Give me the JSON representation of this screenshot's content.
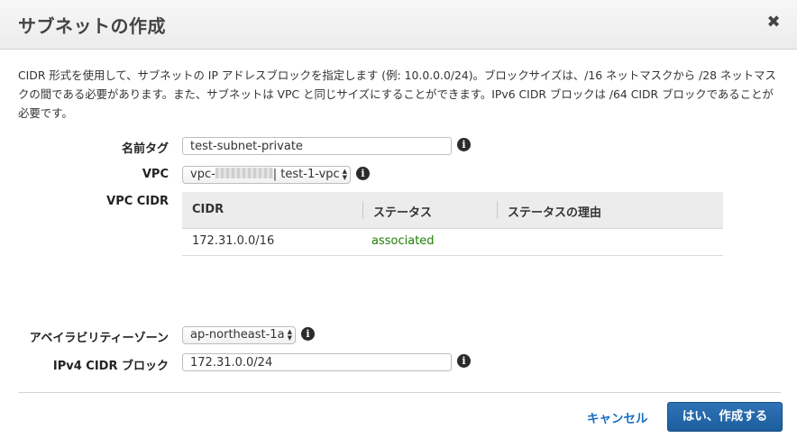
{
  "dialog": {
    "title": "サブネットの作成",
    "close_label": "✖",
    "description": "CIDR 形式を使用して、サブネットの IP アドレスブロックを指定します (例: 10.0.0.0/24)。ブロックサイズは、/16 ネットマスクから /28 ネットマスクの間である必要があります。また、サブネットは VPC と同じサイズにすることができます。IPv6 CIDR ブロックは /64 CIDR ブロックであることが必要です。"
  },
  "form": {
    "name_tag": {
      "label": "名前タグ",
      "value": "test-subnet-private"
    },
    "vpc": {
      "label": "VPC",
      "prefix": "vpc-",
      "suffix": "| test-1-vpc"
    },
    "vpc_cidr": {
      "label": "VPC CIDR",
      "columns": [
        "CIDR",
        "ステータス",
        "ステータスの理由"
      ],
      "rows": [
        {
          "cidr": "172.31.0.0/16",
          "status": "associated",
          "reason": ""
        }
      ]
    },
    "az": {
      "label": "アベイラビリティーゾーン",
      "value": "ap-northeast-1a"
    },
    "ipv4_cidr": {
      "label": "IPv4 CIDR ブロック",
      "value": "172.31.0.0/24"
    }
  },
  "footer": {
    "cancel_label": "キャンセル",
    "confirm_label": "はい、作成する"
  },
  "icons": {
    "info": "info-icon",
    "close": "close-icon",
    "select_arrows": "select-arrows-icon"
  },
  "colors": {
    "accent": "#1a6fc0",
    "primary_button": "#1c5e9e",
    "status_ok": "#1d8102"
  }
}
